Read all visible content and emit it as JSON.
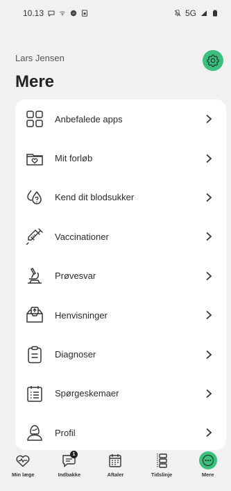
{
  "status_bar": {
    "time": "10.13",
    "network": "5G"
  },
  "header": {
    "user_name": "Lars Jensen",
    "title": "Mere",
    "settings_icon": "gear-icon"
  },
  "menu": {
    "items": [
      {
        "label": "Anbefalede apps",
        "icon": "apps-grid-icon"
      },
      {
        "label": "Mit forløb",
        "icon": "folder-heart-icon"
      },
      {
        "label": "Kend dit blodsukker",
        "icon": "blood-drop-question-icon"
      },
      {
        "label": "Vaccinationer",
        "icon": "syringe-icon"
      },
      {
        "label": "Prøvesvar",
        "icon": "microscope-icon"
      },
      {
        "label": "Henvisninger",
        "icon": "inbox-upload-icon"
      },
      {
        "label": "Diagnoser",
        "icon": "clipboard-icon"
      },
      {
        "label": "Spørgeskemaer",
        "icon": "questionnaire-icon"
      },
      {
        "label": "Profil",
        "icon": "person-icon"
      }
    ]
  },
  "bottom_nav": {
    "items": [
      {
        "label": "Min læge",
        "icon": "heart-pulse-icon"
      },
      {
        "label": "Indbakke",
        "icon": "chat-icon",
        "badge": "1"
      },
      {
        "label": "Aftaler",
        "icon": "calendar-icon"
      },
      {
        "label": "Tidslinje",
        "icon": "timeline-icon"
      },
      {
        "label": "Mere",
        "icon": "more-dots-icon",
        "active": true
      }
    ]
  },
  "colors": {
    "accent": "#3cc07e",
    "background": "#f1f1f1",
    "card": "#ffffff"
  }
}
